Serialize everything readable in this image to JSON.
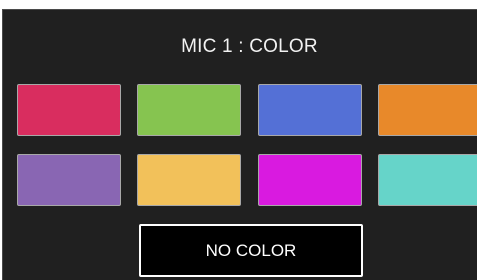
{
  "dialog": {
    "title": "MIC 1 :  COLOR"
  },
  "swatches": [
    {
      "name": "pink-red",
      "color": "#d92d5f"
    },
    {
      "name": "green",
      "color": "#86c450"
    },
    {
      "name": "blue",
      "color": "#5470d6"
    },
    {
      "name": "orange",
      "color": "#e8892a"
    },
    {
      "name": "purple",
      "color": "#8966b3"
    },
    {
      "name": "yellow",
      "color": "#f2c15a"
    },
    {
      "name": "magenta",
      "color": "#d91ae0"
    },
    {
      "name": "teal",
      "color": "#66d4c9"
    }
  ],
  "no_color_button": {
    "label": "NO COLOR"
  }
}
